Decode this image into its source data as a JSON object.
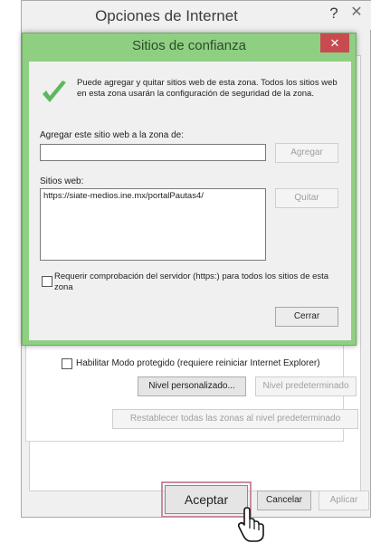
{
  "parent_dialog": {
    "title": "Opciones de Internet",
    "help": "?",
    "close": "✕",
    "protected_mode_label": "Habilitar Modo protegido (requiere reiniciar Internet Explorer)",
    "custom_level_button": "Nivel personalizado...",
    "default_level_button": "Nivel predeterminado",
    "reset_all_button": "Restablecer todas las zonas al nivel predeterminado",
    "ok_button": "Aceptar",
    "cancel_button": "Cancelar",
    "apply_button": "Aplicar"
  },
  "trusted_sites_dialog": {
    "title": "Sitios de confianza",
    "close": "✕",
    "info_text": "Puede agregar y quitar sitios web de esta zona. Todos los sitios web en esta zona usarán la configuración de seguridad de la zona.",
    "add_label": "Agregar este sitio web a la zona de:",
    "url_input_value": "",
    "add_button": "Agregar",
    "websites_label": "Sitios web:",
    "websites": [
      "https://siate-medios.ine.mx/portalPautas4/"
    ],
    "remove_button": "Quitar",
    "require_https_label": "Requerir comprobación del servidor (https:) para todos los sitios de esta zona",
    "require_https_checked": false,
    "close_button": "Cerrar"
  },
  "colors": {
    "dialog_frame": "#8fcf82",
    "close_red": "#c74b50",
    "checkmark_green": "#5cb85c",
    "ok_highlight": "#c98ca2"
  },
  "icons": {
    "checkmark": "checkmark-icon",
    "cursor": "mouse-pointer-icon"
  }
}
